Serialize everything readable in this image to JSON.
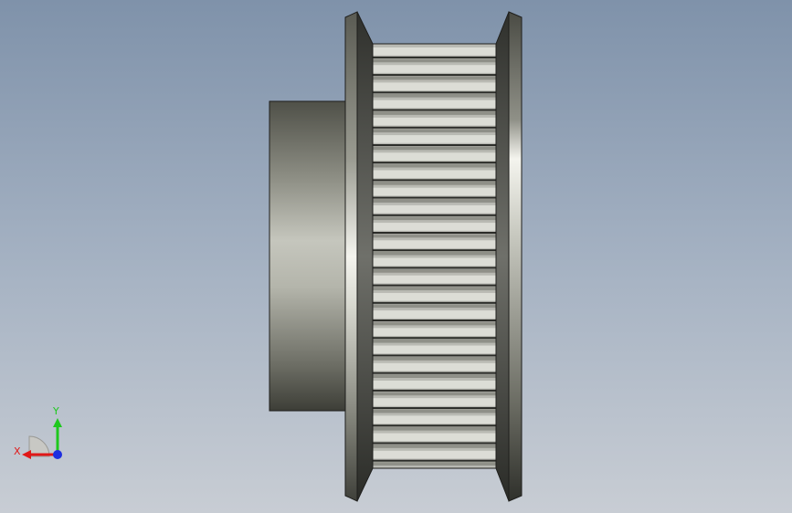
{
  "viewport": {
    "background_top": "#7f92aa",
    "background_bottom": "#c8cdd4"
  },
  "model": {
    "name": "timing-pulley",
    "view": "side",
    "tooth_count_visible": 24,
    "colors": {
      "metal_dark": "#45463f",
      "metal_mid": "#8b8c82",
      "metal_light": "#e9e9e2",
      "edge": "#1e1e1c"
    }
  },
  "triad": {
    "x_label": "X",
    "y_label": "Y",
    "x_color": "#e01818",
    "y_color": "#1ec81e",
    "z_color": "#1d2ee0"
  }
}
